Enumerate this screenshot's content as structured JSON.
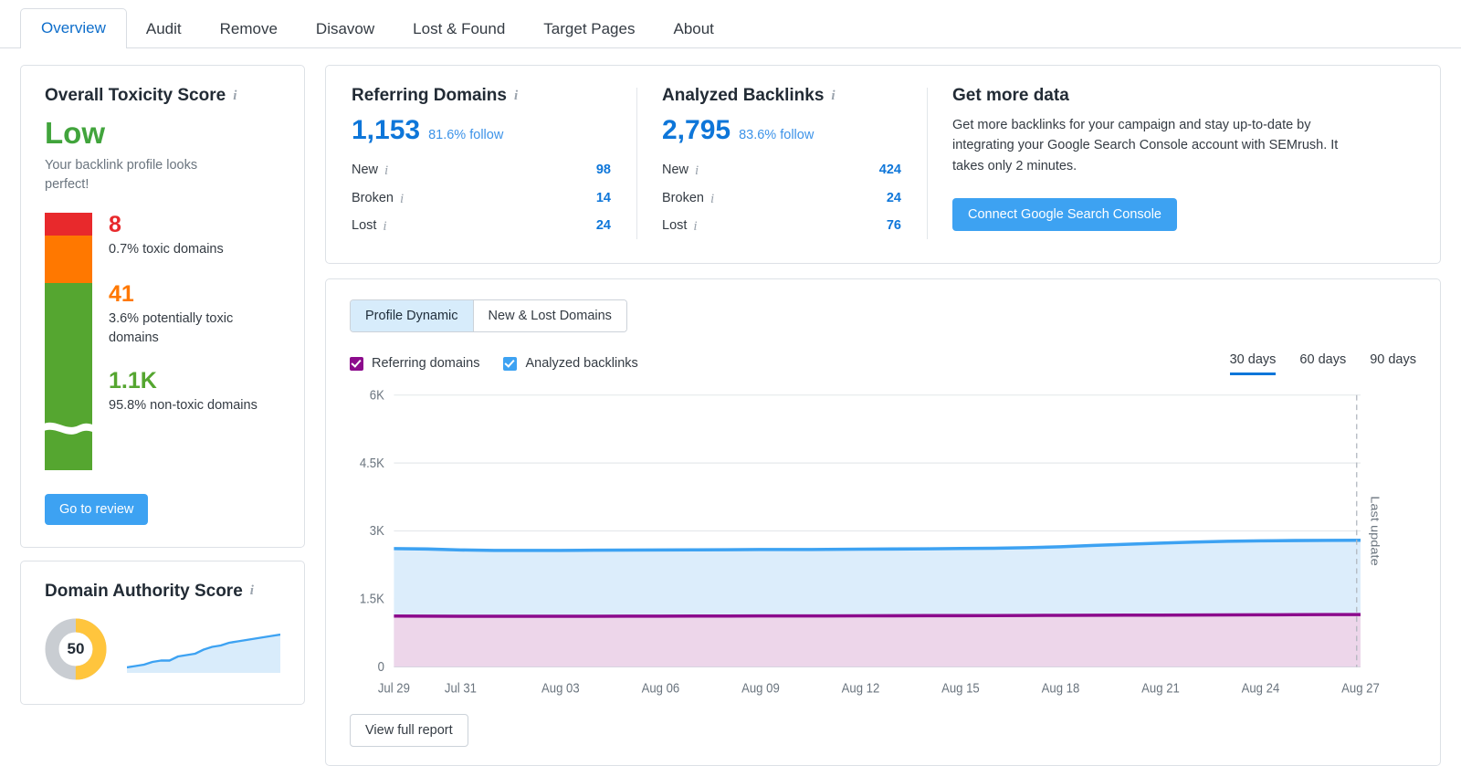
{
  "tabs": [
    {
      "label": "Overview",
      "active": true
    },
    {
      "label": "Audit",
      "active": false
    },
    {
      "label": "Remove",
      "active": false
    },
    {
      "label": "Disavow",
      "active": false
    },
    {
      "label": "Lost & Found",
      "active": false
    },
    {
      "label": "Target Pages",
      "active": false
    },
    {
      "label": "About",
      "active": false
    }
  ],
  "toxicity": {
    "title": "Overall Toxicity Score",
    "info_icon": "info-icon",
    "level": "Low",
    "level_color": "#41a43c",
    "subtitle": "Your backlink profile looks perfect!",
    "segments": [
      {
        "count": "8",
        "label": "0.7% toxic domains",
        "color": "#e8292c",
        "name": "toxic"
      },
      {
        "count": "41",
        "label": "3.6% potentially toxic domains",
        "color": "#ff7800",
        "name": "potentially-toxic"
      },
      {
        "count": "1.1K",
        "label": "95.8% non-toxic domains",
        "color": "#55a630",
        "name": "non-toxic"
      }
    ],
    "review_button": "Go to review"
  },
  "domain_authority": {
    "title": "Domain Authority Score",
    "info_icon": "info-icon",
    "score": "50",
    "score_max": 100,
    "donut_color": "#ffc53d",
    "donut_track": "#c9cdd2",
    "sparkline": [
      18,
      19,
      20,
      22,
      23,
      23,
      26,
      27,
      28,
      31,
      33,
      34,
      36,
      37,
      38,
      39,
      40,
      41,
      42
    ]
  },
  "stats": {
    "referring_domains": {
      "title": "Referring Domains",
      "info_icon": "info-icon",
      "total": "1,153",
      "follow": "81.6% follow",
      "rows": [
        {
          "label": "New",
          "value": "98"
        },
        {
          "label": "Broken",
          "value": "14"
        },
        {
          "label": "Lost",
          "value": "24"
        }
      ]
    },
    "analyzed_backlinks": {
      "title": "Analyzed Backlinks",
      "info_icon": "info-icon",
      "total": "2,795",
      "follow": "83.6% follow",
      "rows": [
        {
          "label": "New",
          "value": "424"
        },
        {
          "label": "Broken",
          "value": "24"
        },
        {
          "label": "Lost",
          "value": "76"
        }
      ]
    },
    "get_more_data": {
      "title": "Get more data",
      "text": "Get more backlinks for your campaign and stay up-to-date by integrating your Google Search Console account with SEMrush. It takes only 2 minutes.",
      "button": "Connect Google Search Console"
    }
  },
  "chart_panel": {
    "view_buttons": [
      {
        "label": "Profile Dynamic",
        "active": true
      },
      {
        "label": "New & Lost Domains",
        "active": false
      }
    ],
    "legend": [
      {
        "label": "Referring domains",
        "color": "#8c0b8c",
        "checked": true
      },
      {
        "label": "Analyzed backlinks",
        "color": "#3da2f2",
        "checked": true
      }
    ],
    "ranges": [
      {
        "label": "30 days",
        "active": true
      },
      {
        "label": "60 days",
        "active": false
      },
      {
        "label": "90 days",
        "active": false
      }
    ],
    "last_update_label": "Last update",
    "view_report_button": "View full report"
  },
  "chart_data": {
    "type": "area",
    "title": "Profile Dynamic",
    "xlabel": "",
    "ylabel": "",
    "ylim": [
      0,
      6000
    ],
    "yticks": [
      0,
      1500,
      3000,
      4500,
      6000
    ],
    "ytick_labels": [
      "0",
      "1.5K",
      "3K",
      "4.5K",
      "6K"
    ],
    "grid": true,
    "legend_position": "top-left",
    "x": [
      "Jul 29",
      "Jul 30",
      "Jul 31",
      "Aug 01",
      "Aug 02",
      "Aug 03",
      "Aug 04",
      "Aug 05",
      "Aug 06",
      "Aug 07",
      "Aug 08",
      "Aug 09",
      "Aug 10",
      "Aug 11",
      "Aug 12",
      "Aug 13",
      "Aug 14",
      "Aug 15",
      "Aug 16",
      "Aug 17",
      "Aug 18",
      "Aug 19",
      "Aug 20",
      "Aug 21",
      "Aug 22",
      "Aug 23",
      "Aug 24",
      "Aug 25",
      "Aug 26",
      "Aug 27"
    ],
    "xtick_labels": [
      "Jul 29",
      "Jul 31",
      "Aug 03",
      "Aug 06",
      "Aug 09",
      "Aug 12",
      "Aug 15",
      "Aug 18",
      "Aug 21",
      "Aug 24",
      "Aug 27"
    ],
    "series": [
      {
        "name": "Analyzed backlinks",
        "color": "#3da2f2",
        "fill": "#dcedfb",
        "values": [
          2610,
          2600,
          2580,
          2570,
          2570,
          2570,
          2575,
          2578,
          2580,
          2582,
          2585,
          2588,
          2590,
          2592,
          2595,
          2600,
          2605,
          2612,
          2618,
          2630,
          2650,
          2680,
          2705,
          2730,
          2755,
          2770,
          2780,
          2788,
          2792,
          2795
        ]
      },
      {
        "name": "Referring domains",
        "color": "#8c0b8c",
        "fill": "#edd6ea",
        "values": [
          1120,
          1118,
          1115,
          1114,
          1114,
          1115,
          1116,
          1117,
          1118,
          1119,
          1120,
          1121,
          1122,
          1123,
          1124,
          1126,
          1128,
          1130,
          1132,
          1134,
          1136,
          1138,
          1140,
          1142,
          1144,
          1146,
          1148,
          1150,
          1152,
          1153
        ]
      }
    ],
    "annotations": [
      {
        "type": "vline",
        "x": "Aug 27",
        "label": "Last update",
        "style": "dashed"
      }
    ]
  }
}
